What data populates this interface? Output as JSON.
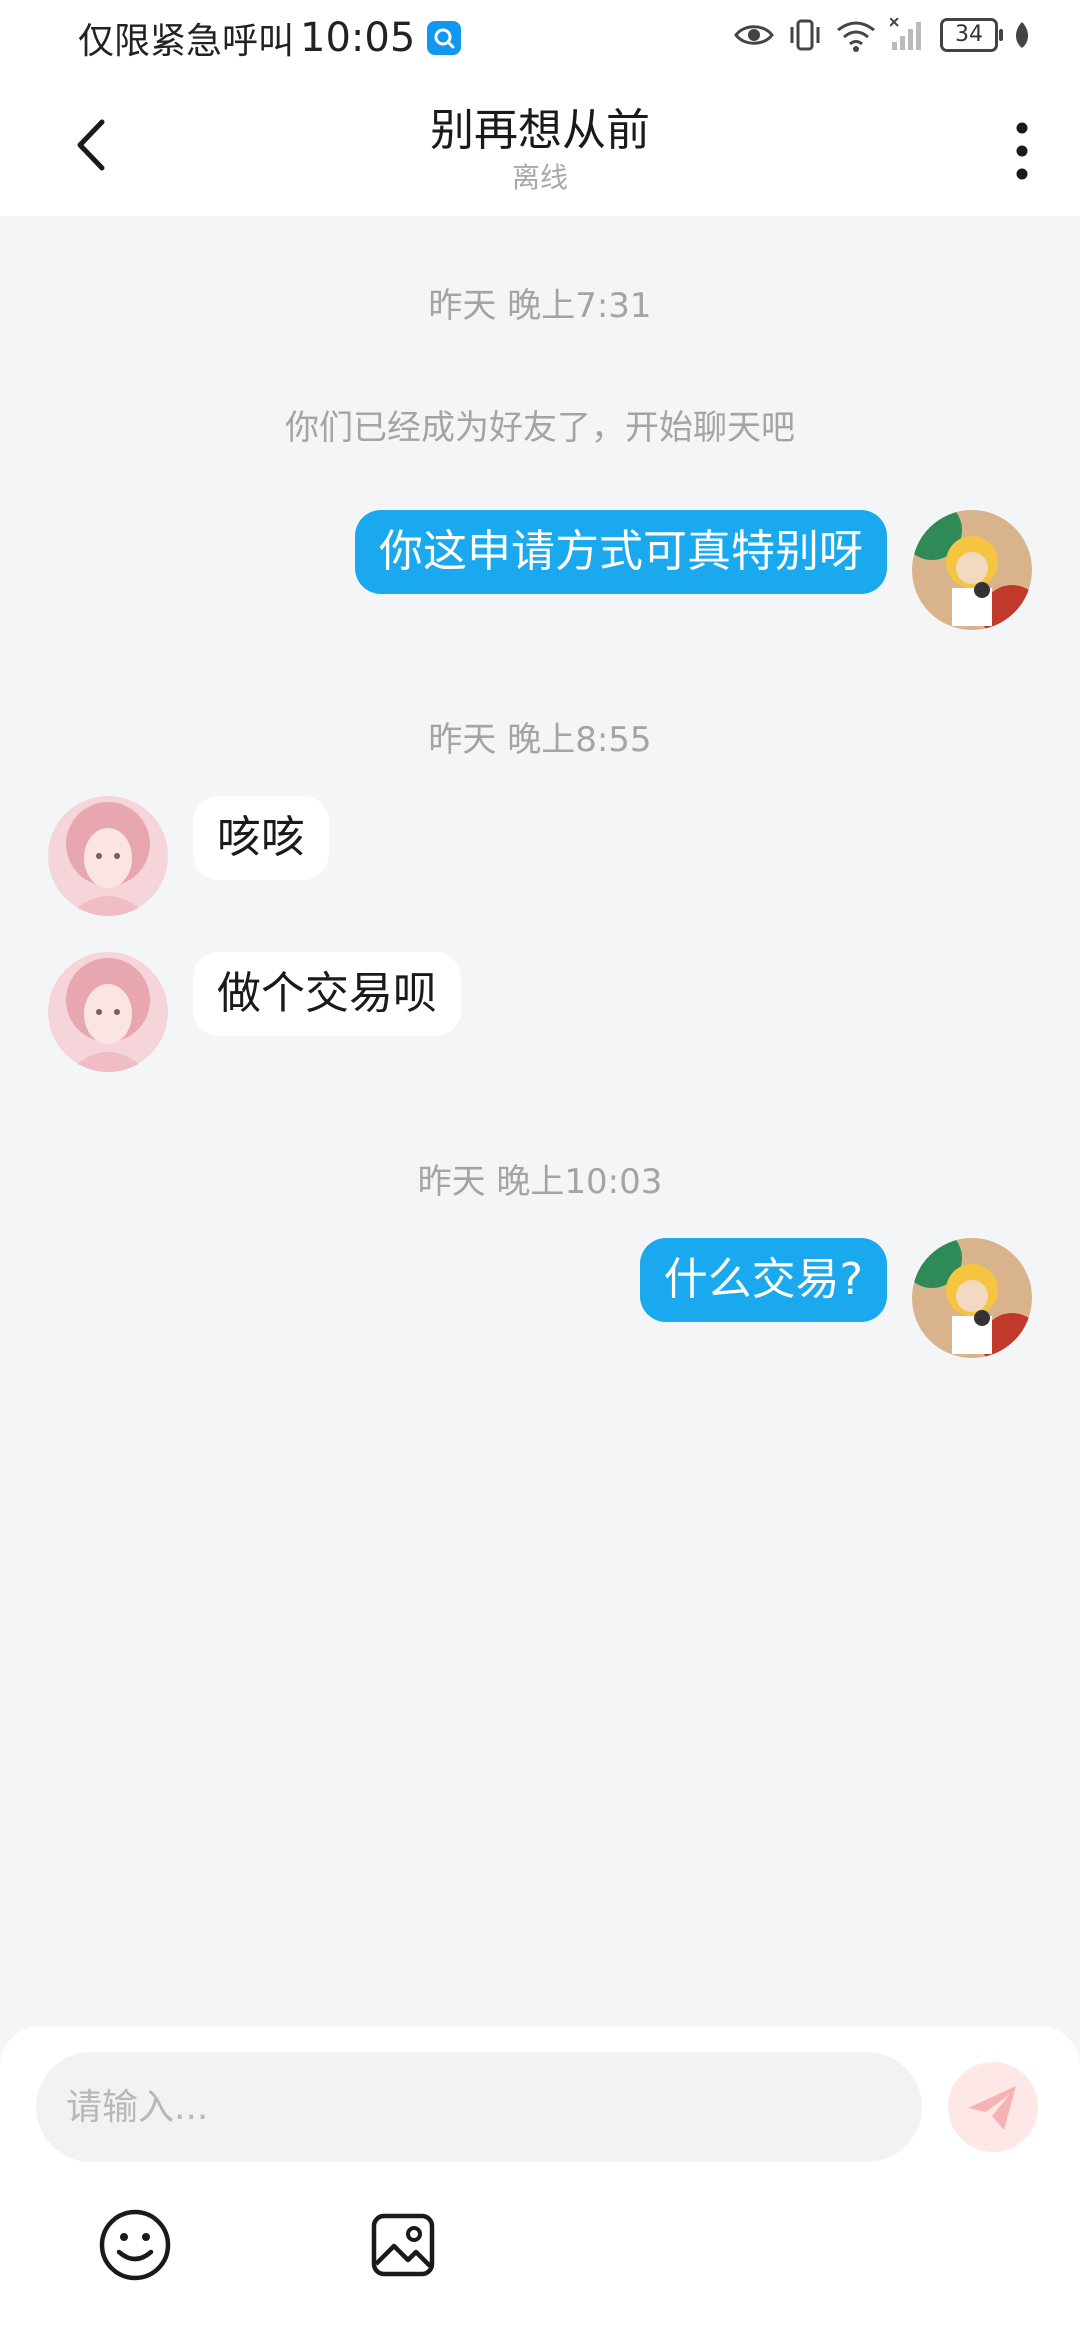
{
  "status_bar": {
    "carrier_text": "仅限紧急呼叫",
    "time": "10:05",
    "battery": "34"
  },
  "header": {
    "title": "别再想从前",
    "subtitle": "离线"
  },
  "messages": {
    "time_1": "昨天 晚上7:31",
    "system_1": "你们已经成为好友了，开始聊天吧",
    "out_1": "你这申请方式可真特别呀",
    "time_2": "昨天 晚上8:55",
    "in_1": "咳咳",
    "in_2": "做个交易呗",
    "time_3": "昨天 晚上10:03",
    "out_2": "什么交易?"
  },
  "input": {
    "placeholder": "请输入..."
  },
  "colors": {
    "accent_bubble": "#1aa8ee",
    "background": "#f4f5f7",
    "send_button_bg": "#fde7e7",
    "send_icon": "#f7b3b3"
  },
  "icons": {
    "back": "chevron-left-icon",
    "more": "more-vertical-icon",
    "emoji": "smiley-icon",
    "image": "image-icon",
    "send": "paper-plane-icon"
  }
}
